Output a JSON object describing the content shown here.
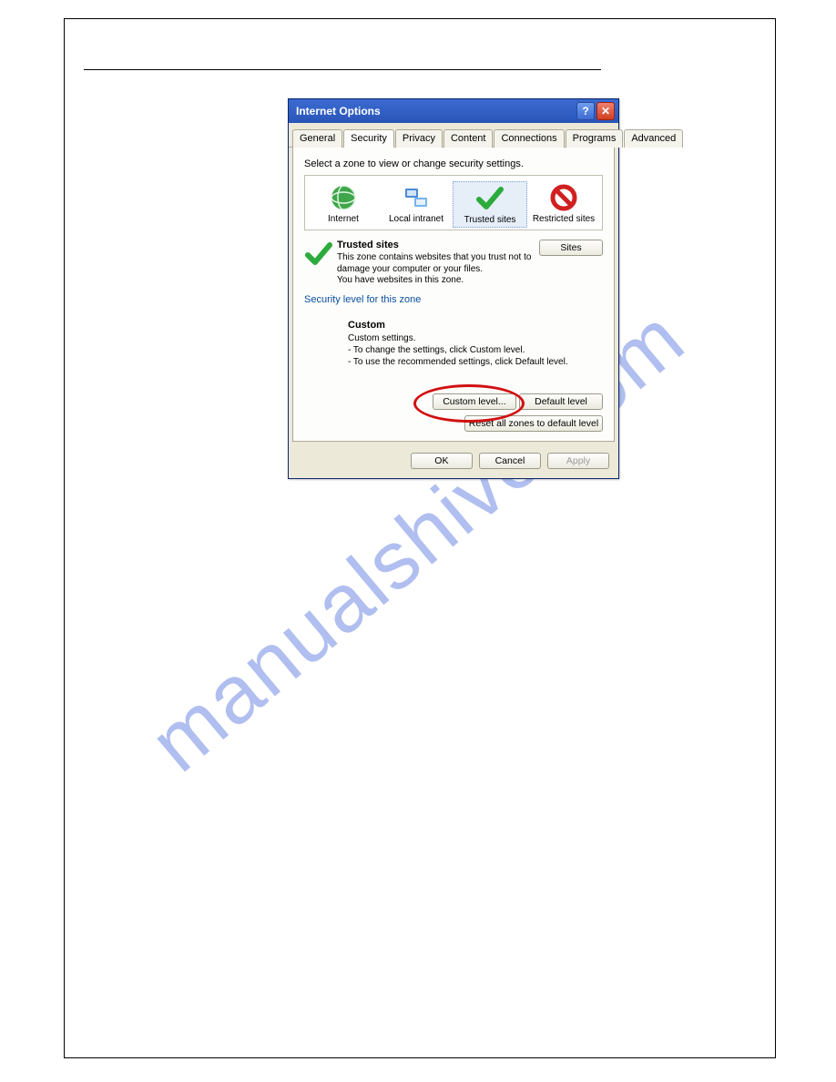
{
  "watermark": "manualshive.com",
  "dialog": {
    "title": "Internet Options",
    "tabs": [
      "General",
      "Security",
      "Privacy",
      "Content",
      "Connections",
      "Programs",
      "Advanced"
    ],
    "active_tab_index": 1,
    "instruction": "Select a zone to view or change security settings.",
    "zones": [
      {
        "label": "Internet"
      },
      {
        "label": "Local intranet"
      },
      {
        "label": "Trusted sites"
      },
      {
        "label": "Restricted sites"
      }
    ],
    "selected_zone_index": 2,
    "zone_detail": {
      "heading": "Trusted sites",
      "body_line1": "This zone contains websites that you trust not to damage your computer or your files.",
      "body_line2": "You have websites in this zone."
    },
    "sites_button": "Sites",
    "security_level_link": "Security level for this zone",
    "custom": {
      "heading": "Custom",
      "line1": "Custom settings.",
      "line2": "- To change the settings, click Custom level.",
      "line3": "- To use the recommended settings, click Default level."
    },
    "buttons": {
      "custom_level": "Custom level...",
      "default_level": "Default level",
      "reset_all": "Reset all zones to default level",
      "ok": "OK",
      "cancel": "Cancel",
      "apply": "Apply"
    }
  }
}
